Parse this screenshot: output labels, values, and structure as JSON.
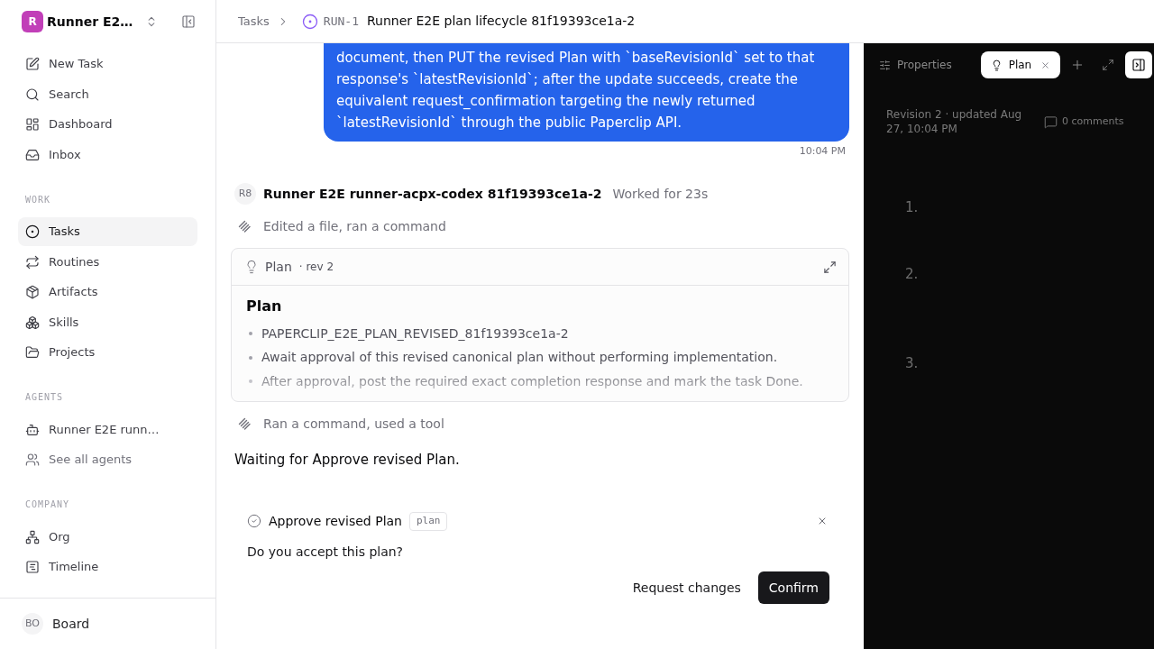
{
  "sidebar": {
    "workspace": {
      "logo_letter": "R",
      "name": "Runner E2…"
    },
    "top_items": [
      {
        "label": "New Task",
        "selected": false
      },
      {
        "label": "Search",
        "selected": false
      },
      {
        "label": "Dashboard",
        "selected": false
      },
      {
        "label": "Inbox",
        "selected": false
      }
    ],
    "groups": [
      {
        "title": "WORK",
        "items": [
          {
            "label": "Tasks",
            "selected": true
          },
          {
            "label": "Routines",
            "selected": false
          },
          {
            "label": "Artifacts",
            "selected": false
          },
          {
            "label": "Skills",
            "selected": false
          },
          {
            "label": "Projects",
            "selected": false
          }
        ]
      },
      {
        "title": "AGENTS",
        "items": [
          {
            "label": "Runner E2E runn…",
            "selected": false,
            "kind": "agent"
          },
          {
            "label": "See all agents",
            "selected": false,
            "kind": "more"
          }
        ]
      },
      {
        "title": "COMPANY",
        "items": [
          {
            "label": "Org",
            "selected": false
          },
          {
            "label": "Timeline",
            "selected": false
          }
        ]
      }
    ],
    "user": {
      "avatar": "BO",
      "name": "Board"
    }
  },
  "breadcrumb": {
    "parent": "Tasks",
    "run_id": "RUN-1",
    "title": "Runner E2E plan lifecycle 81f19393ce1a-2"
  },
  "thread": {
    "user_message": {
      "text": "document, then PUT the revised Plan with `baseRevisionId` set to that response's `latestRevisionId`; after the update succeeds, create the equivalent request_confirmation targeting the newly returned `latestRevisionId` through the public Paperclip API.",
      "time": "10:04 PM"
    },
    "agent": {
      "avatar": "R8",
      "name": "Runner E2E runner-acpx-codex 81f19393ce1a-2",
      "status": "Worked for 23s"
    },
    "events": [
      {
        "kind": "activity",
        "text": "Edited a file, ran a command"
      },
      {
        "kind": "plan",
        "header": "Plan",
        "revision": "· rev 2",
        "title": "Plan",
        "items": [
          "PAPERCLIP_E2E_PLAN_REVISED_81f19393ce1a-2",
          "Await approval of this revised canonical plan without performing implementation.",
          "After approval, post the required exact completion response and mark the task Done."
        ],
        "collapsed": true
      },
      {
        "kind": "activity",
        "text": "Ran a command, used a tool"
      },
      {
        "kind": "text",
        "text": "Waiting for Approve revised Plan."
      }
    ],
    "approval": {
      "title": "Approve revised Plan",
      "tag": "plan",
      "question": "Do you accept this plan?",
      "buttons": [
        {
          "label": "Request changes",
          "kind": "secondary"
        },
        {
          "label": "Confirm",
          "kind": "primary"
        }
      ]
    }
  },
  "side_panel": {
    "tabs": [
      {
        "label": "Properties",
        "selected": false,
        "closable": false
      },
      {
        "label": "Plan",
        "selected": true,
        "closable": true
      }
    ],
    "meta": "Revision 2 · updated Aug 27, 10:04 PM",
    "comments": "0 comments",
    "list_markers": [
      "1.",
      "2.",
      "3."
    ]
  }
}
